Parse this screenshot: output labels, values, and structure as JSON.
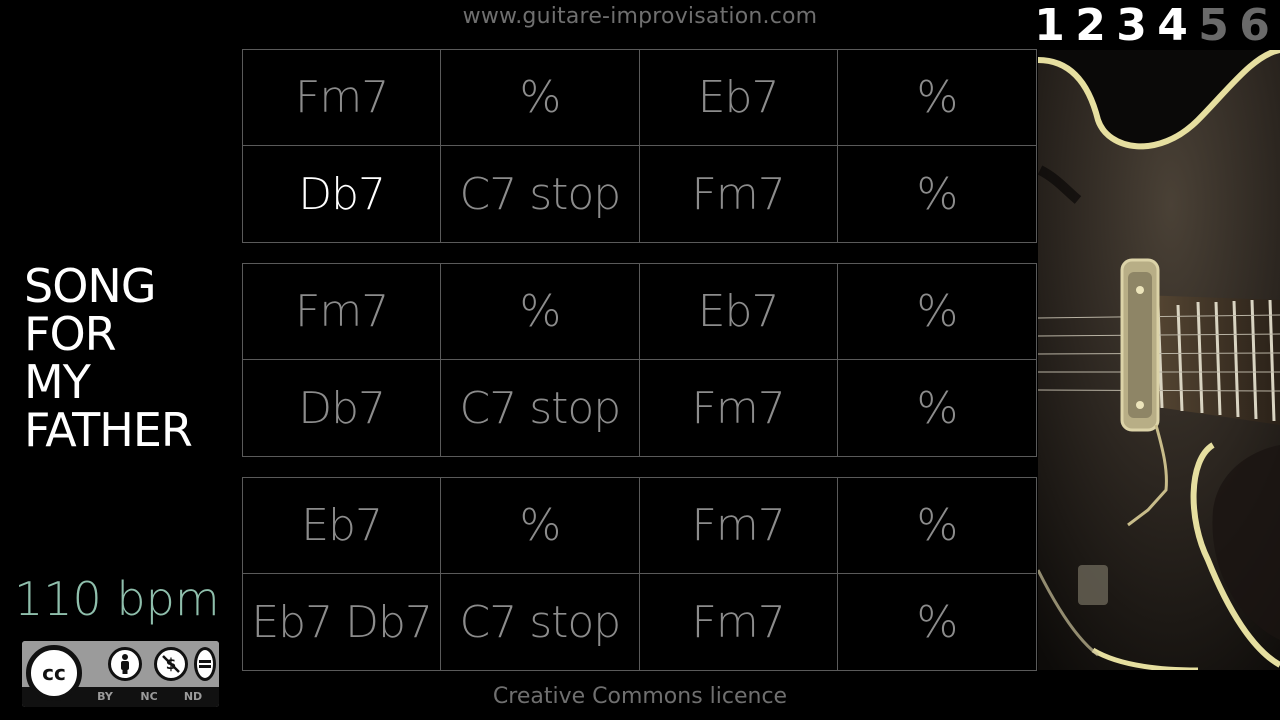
{
  "header": {
    "site_url": "www.guitare-improvisation.com"
  },
  "beat_counter": {
    "beats": [
      "1",
      "2",
      "3",
      "4",
      "5",
      "6"
    ],
    "active_count": 4
  },
  "song": {
    "title_lines": [
      "SONG",
      "FOR",
      "MY",
      "FATHER"
    ],
    "tempo": "110 bpm"
  },
  "licence": {
    "badge_labels": [
      "BY",
      "NC",
      "ND"
    ],
    "badge_logo": "cc",
    "footer_text": "Creative Commons licence"
  },
  "chord_grid": {
    "active_chord": "Db7",
    "sections": [
      {
        "rows": [
          [
            "Fm7",
            "%",
            "Eb7",
            "%"
          ],
          [
            "Db7",
            "C7 stop",
            "Fm7",
            "%"
          ]
        ]
      },
      {
        "rows": [
          [
            "Fm7",
            "%",
            "Eb7",
            "%"
          ],
          [
            "Db7",
            "C7 stop",
            "Fm7",
            "%"
          ]
        ]
      },
      {
        "rows": [
          [
            "Eb7",
            "%",
            "Fm7",
            "%"
          ],
          [
            "Eb7 Db7",
            "C7 stop",
            "Fm7",
            "%"
          ]
        ]
      }
    ]
  },
  "colors": {
    "background": "#000000",
    "grid_line": "#5a5a5a",
    "chord_inactive": "#8c8c8c",
    "chord_active": "#ffffff",
    "tempo_text": "#8fbfac",
    "muted_text": "#6f6f6f",
    "guitar_binding": "#e6dfa0"
  },
  "image": {
    "subject": "guitar-photo"
  }
}
